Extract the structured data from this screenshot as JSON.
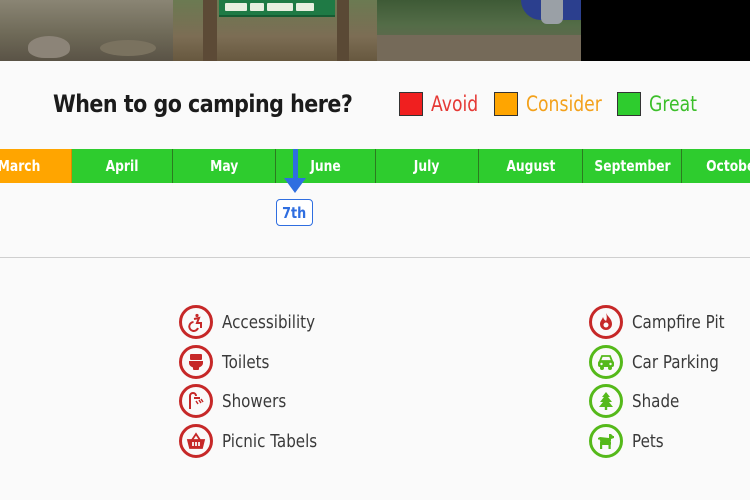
{
  "heading": "When to go camping here?",
  "legend": [
    {
      "label": "Avoid",
      "color": "#f01f1f",
      "text_color": "#e53935"
    },
    {
      "label": "Consider",
      "color": "#ffa500",
      "text_color": "#f3a11b"
    },
    {
      "label": "Great",
      "color": "#2ecc2e",
      "text_color": "#3cbf2a"
    }
  ],
  "months": [
    {
      "label": "March",
      "rating": "Consider"
    },
    {
      "label": "April",
      "rating": "Great"
    },
    {
      "label": "May",
      "rating": "Great"
    },
    {
      "label": "June",
      "rating": "Great"
    },
    {
      "label": "July",
      "rating": "Great"
    },
    {
      "label": "August",
      "rating": "Great"
    },
    {
      "label": "September",
      "rating": "Great"
    },
    {
      "label": "October",
      "rating": "Great"
    }
  ],
  "today_marker": {
    "label": "7th",
    "month": "June",
    "color": "#2f6ee0"
  },
  "amenities": {
    "unavailable": [
      {
        "label": "Accessibility",
        "icon": "accessibility-icon"
      },
      {
        "label": "Toilets",
        "icon": "toilet-icon"
      },
      {
        "label": "Showers",
        "icon": "shower-icon"
      },
      {
        "label": "Picnic Tabels",
        "icon": "picnic-basket-icon"
      }
    ],
    "available": [
      {
        "label": "Campfire Pit",
        "icon": "fire-icon"
      },
      {
        "label": "Car Parking",
        "icon": "car-icon"
      },
      {
        "label": "Shade",
        "icon": "tree-icon"
      },
      {
        "label": "Pets",
        "icon": "dog-icon"
      }
    ]
  },
  "colors": {
    "unavailable": "#c62828",
    "available": "#55b91a"
  }
}
